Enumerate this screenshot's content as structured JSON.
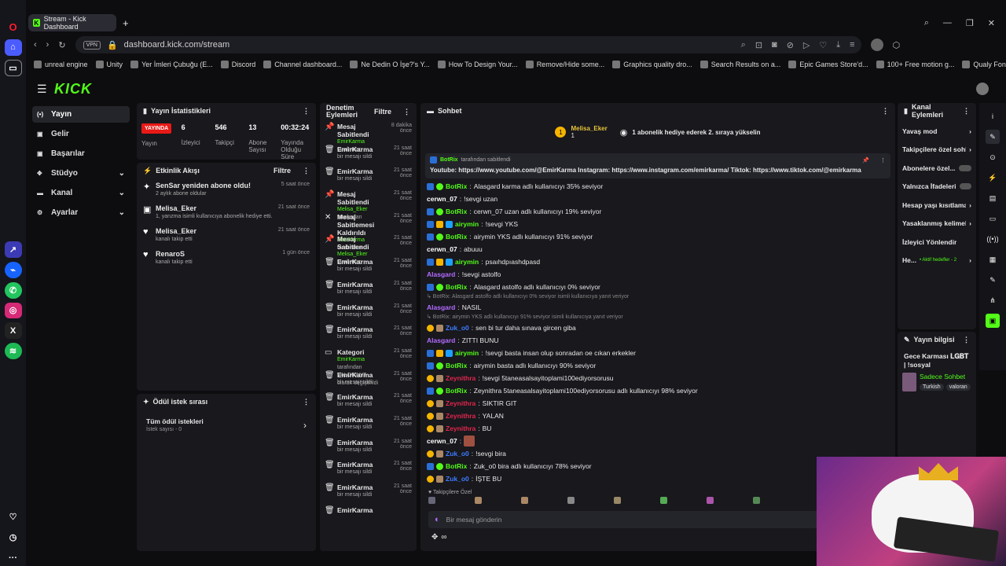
{
  "browser": {
    "tab_title": "Stream - Kick Dashboard",
    "url": "dashboard.kick.com/stream",
    "vpn": "VPN",
    "bookmarks": [
      "unreal engine",
      "Unity",
      "Yer İmleri Çubuğu (E...",
      "Discord",
      "Channel dashboard...",
      "Ne Dedin O İşe?'s Y...",
      "How To Design Your...",
      "Remove/Hide some...",
      "Graphics quality dro...",
      "Search Results on a...",
      "Epic Games Store'd...",
      "100+ Free motion g...",
      "Qualy Font FREE Do..."
    ]
  },
  "logo": "KICK",
  "nav": [
    {
      "label": "Yayın",
      "icon": "(•)"
    },
    {
      "label": "Gelir",
      "icon": "▣"
    },
    {
      "label": "Başarılar",
      "icon": "▣"
    },
    {
      "label": "Stüdyo",
      "icon": "✥",
      "chev": "⌄"
    },
    {
      "label": "Kanal",
      "icon": "▬",
      "chev": "⌄"
    },
    {
      "label": "Ayarlar",
      "icon": "⚙",
      "chev": "⌄"
    }
  ],
  "stats": {
    "title": "Yayın İstatistikleri",
    "live": "YAYINDA",
    "viewers": "6",
    "viewers_label": "İzleyici",
    "followers": "546",
    "followers_label": "Takipçi",
    "subs": "13",
    "subs_label": "Abone Sayısı",
    "uptime": "00:32:24",
    "uptime_label": "Yayında Olduğu Süre",
    "live_label": "Yayın"
  },
  "activity": {
    "title": "Etkinlik Akışı",
    "filter": "Filtre",
    "items": [
      {
        "title": "SenSar yeniden abone oldu!",
        "sub": "2 aylık abone oldular",
        "time": "5 saat önce",
        "icon": "✦"
      },
      {
        "title": "Melisa_Eker",
        "sub": "1, yanzma isimli kullanıcıya abonelik hediye etti.",
        "time": "21 saat önce",
        "icon": "▣"
      },
      {
        "title": "Melisa_Eker",
        "sub": "kanalı takip etti",
        "time": "21 saat önce",
        "icon": "♥"
      },
      {
        "title": "RenaroS",
        "sub": "kanalı takip etti",
        "time": "1 gün önce",
        "icon": "♥"
      }
    ]
  },
  "rewards": {
    "title": "Ödül istek sırası",
    "all": "Tüm ödül istekleri",
    "count": "İstek sayısı - 0"
  },
  "modlog": {
    "title": "Denetim Eylemleri",
    "filter": "Filtre",
    "items": [
      {
        "t": "Mesaj Sabitlendi",
        "s": "EmirKarma",
        "s2": "tarafından",
        "tm": "8 dakika önce",
        "ic": "📌"
      },
      {
        "t": "EmirKarma",
        "s": "",
        "s2": "bir mesajı sildi",
        "tm": "21 saat önce",
        "ic": "🗑"
      },
      {
        "t": "EmirKarma",
        "s": "",
        "s2": "bir mesajı sildi",
        "tm": "21 saat önce",
        "ic": "🗑"
      },
      {
        "t": "Mesaj Sabitlendi",
        "s": "Melisa_Eker",
        "s2": "tarafından",
        "tm": "21 saat önce",
        "ic": "📌"
      },
      {
        "t": "Mesaj Sabitlemesi Kaldırıldı",
        "s": "EmirKarma",
        "s2": "tarafından",
        "tm": "21 saat önce",
        "ic": "✕"
      },
      {
        "t": "Mesaj Sabitlendi",
        "s": "Melisa_Eker",
        "s2": "tarafından",
        "tm": "21 saat önce",
        "ic": "📌"
      },
      {
        "t": "EmirKarma",
        "s": "",
        "s2": "bir mesajı sildi",
        "tm": "21 saat önce",
        "ic": "🗑"
      },
      {
        "t": "EmirKarma",
        "s": "",
        "s2": "bir mesajı sildi",
        "tm": "21 saat önce",
        "ic": "🗑"
      },
      {
        "t": "EmirKarma",
        "s": "",
        "s2": "bir mesajı sildi",
        "tm": "21 saat önce",
        "ic": "🗑"
      },
      {
        "t": "EmirKarma",
        "s": "",
        "s2": "bir mesajı sildi",
        "tm": "21 saat önce",
        "ic": "🗑"
      },
      {
        "t": "Kategori",
        "s": "EmirKarma",
        "s2": "tarafından VALORANT olarak değiştirildi",
        "tm": "21 saat önce",
        "ic": "▭"
      },
      {
        "t": "EmirKarma",
        "s": "",
        "s2": "bir mesajı sildi",
        "tm": "21 saat önce",
        "ic": "🗑"
      },
      {
        "t": "EmirKarma",
        "s": "",
        "s2": "bir mesajı sildi",
        "tm": "21 saat önce",
        "ic": "🗑"
      },
      {
        "t": "EmirKarma",
        "s": "",
        "s2": "bir mesajı sildi",
        "tm": "21 saat önce",
        "ic": "🗑"
      },
      {
        "t": "EmirKarma",
        "s": "",
        "s2": "bir mesajı sildi",
        "tm": "21 saat önce",
        "ic": "🗑"
      },
      {
        "t": "EmirKarma",
        "s": "",
        "s2": "bir mesajı sildi",
        "tm": "21 saat önce",
        "ic": "🗑"
      },
      {
        "t": "EmirKarma",
        "s": "",
        "s2": "bir mesajı sildi",
        "tm": "21 saat önce",
        "ic": "🗑"
      },
      {
        "t": "EmirKarma",
        "s": "",
        "s2": "",
        "tm": "",
        "ic": "🗑"
      }
    ]
  },
  "chat": {
    "title": "Sohbet",
    "banner_user": "Melisa_Eker",
    "banner_count": "1",
    "banner_text": "1 abonelik hediye ederek 2. sıraya yükselin",
    "pin_by": "BotRix",
    "pin_label": "tarafından sabitlendi",
    "pin_text": "Youtube: https://www.youtube.com/@EmirKarma Instagram: https://www.instagram.com/emirkarma/ Tiktok: https://www.tiktok.com/@emirkarma",
    "messages": [
      {
        "u": "BotRix",
        "c": "#53fc18",
        "m": "Alasgard karma adlı kullanıcıyı 35% seviyor"
      },
      {
        "u": "cerwn_07",
        "c": "#ffffff",
        "m": "!sevgi uzan"
      },
      {
        "u": "BotRix",
        "c": "#53fc18",
        "m": "cerwn_07 uzan adlı kullanıcıyı 19% seviyor"
      },
      {
        "u": "airymin",
        "c": "#53fc18",
        "m": "!sevgi YKS"
      },
      {
        "u": "BotRix",
        "c": "#53fc18",
        "m": "airymin YKS adlı kullanıcıyı 91% seviyor"
      },
      {
        "u": "cerwn_07",
        "c": "#ffffff",
        "m": "abuuu"
      },
      {
        "u": "airymin",
        "c": "#53fc18",
        "m": "psaıhdpıashdpasd"
      },
      {
        "u": "Alasgard",
        "c": "#b36bff",
        "m": "!sevgi astolfo"
      },
      {
        "u": "BotRix",
        "c": "#53fc18",
        "m": "Alasgard astolfo adlı kullanıcıyı 0% seviyor"
      },
      {
        "reply": "↳ BotRix: Alasgard astolfo adlı kullanıcıyı 0% seviyor isimli kullanıcıya yanıt veriyor"
      },
      {
        "u": "Alasgard",
        "c": "#b36bff",
        "m": "NASIL"
      },
      {
        "reply": "↳ BotRix: airymin YKS adlı kullanıcıyı 91% seviyor isimli kullanıcıya yanıt veriyor"
      },
      {
        "u": "Zuk_o0",
        "c": "#3e7bff",
        "m": "sen bi tur daha sınava gircen giba"
      },
      {
        "u": "Alasgard",
        "c": "#b36bff",
        "m": "ZITTI BUNU"
      },
      {
        "u": "airymin",
        "c": "#53fc18",
        "m": "!sevgi basta insan olup sonradan oe cıkan erkekler"
      },
      {
        "u": "BotRix",
        "c": "#53fc18",
        "m": "airymin basta adlı kullanıcıyı 90% seviyor"
      },
      {
        "u": "Zeynithra",
        "c": "#e0264c",
        "m": "!sevgi 5taneasalsayitoplami100ediyorsorusu"
      },
      {
        "u": "BotRix",
        "c": "#53fc18",
        "m": "Zeynithra 5taneasalsayitoplami100ediyorsorusu adlı kullanıcıyı 98% seviyor"
      },
      {
        "u": "Zeynithra",
        "c": "#e0264c",
        "m": "SIKTIR GIT"
      },
      {
        "u": "Zeynithra",
        "c": "#e0264c",
        "m": "YALAN"
      },
      {
        "u": "Zeynithra",
        "c": "#e0264c",
        "m": "BU"
      },
      {
        "u": "cerwn_07",
        "c": "#ffffff",
        "m": ""
      },
      {
        "u": "Zuk_o0",
        "c": "#3e7bff",
        "m": "!sevgi bira"
      },
      {
        "u": "BotRix",
        "c": "#53fc18",
        "m": "Zuk_o0 bira adlı kullanıcıyı 78% seviyor"
      },
      {
        "u": "Zuk_o0",
        "c": "#3e7bff",
        "m": "İŞTE BU"
      }
    ],
    "followers_only": "♥ Takipçilere Özel",
    "input_placeholder": "Bir mesaj gönderin",
    "footer": "∞"
  },
  "channel_actions": {
    "title": "Kanal Eylemleri",
    "items": [
      "Yavaş mod",
      "Takipçilere özel sohbet",
      "Abonelere özel...",
      "Yalnızca İfadeleri...",
      "Hesap yaşı kısıtlaması",
      "Yasaklanmış kelimeler",
      "İzleyici Yönlendir",
      "He..."
    ],
    "sub_note": "• Aktif hedefler - 2"
  },
  "stream_info": {
    "title": "Yayın bilgisi",
    "stream_title": "Gece Karması 𝐋𝐆𝐁𝐓 | !sosyal",
    "category": "Sadece Sohbet",
    "tags": [
      "Turkish",
      "valoran"
    ]
  }
}
